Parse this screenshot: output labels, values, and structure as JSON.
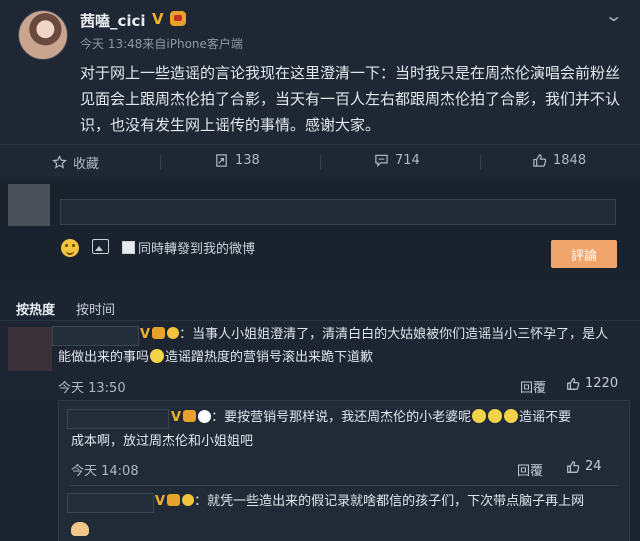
{
  "post": {
    "username": "茜嗑_cici",
    "time": "今天 13:48",
    "source": "来自iPhone客户端",
    "text": "对于网上一些造谣的言论我现在这里澄清一下：当时我只是在周杰伦演唱会前粉丝见面会上跟周杰伦拍了合影，当天有一百人左右都跟周杰伦拍了合影，我们并不认识，也没有发生网上谣传的事情。感谢大家。",
    "actions": {
      "favorite_label": "收藏",
      "repost_count": "138",
      "comment_count": "714",
      "like_count": "1848"
    }
  },
  "composer": {
    "also_repost_label": "同時轉發到我的微博",
    "submit_label": "評論"
  },
  "sort": {
    "hot_label": "按热度",
    "time_label": "按时间"
  },
  "comments": [
    {
      "text_line1": "：当事人小姐姐澄清了，清清白白的大姑娘被你们造谣当小三怀孕了，是人",
      "text_line2a": "能做出来的事吗",
      "text_line2b": "造谣蹭热度的营销号滚出来跪下道歉",
      "time": "今天 13:50",
      "reply_label": "回覆",
      "likes": "1220"
    }
  ],
  "replies": [
    {
      "text_line1a": "：要按营销号那样说，我还周杰伦的小老婆呢",
      "text_line1b": "造谣不要",
      "text_line2": "成本啊，放过周杰伦和小姐姐吧",
      "time": "今天 14:08",
      "reply_label": "回覆",
      "likes": "24"
    },
    {
      "text_line1": "：就凭一些造出来的假记录就啥都信的孩子们，下次带点脑子再上网"
    }
  ],
  "colors": {
    "background": "#1b2430",
    "accent_badge": "#f2b02a",
    "submit_button": "#f0a56d"
  }
}
